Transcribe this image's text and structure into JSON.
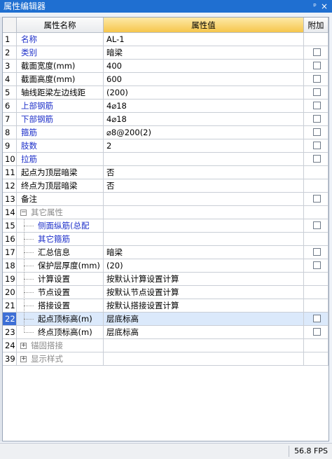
{
  "window": {
    "title": "属性编辑器",
    "pin_glyph": "ᵖ",
    "close_glyph": "×"
  },
  "header": {
    "name": "属性名称",
    "value": "属性值",
    "add": "附加"
  },
  "rows": [
    {
      "num": "1",
      "name": "名称",
      "value": "AL-1",
      "name_color": "blue",
      "check": false,
      "indent": 0
    },
    {
      "num": "2",
      "name": "类别",
      "value": "暗梁",
      "name_color": "blue",
      "check": true,
      "indent": 0
    },
    {
      "num": "3",
      "name": "截面宽度(mm)",
      "value": "400",
      "name_color": "black",
      "check": true,
      "indent": 0
    },
    {
      "num": "4",
      "name": "截面高度(mm)",
      "value": "600",
      "name_color": "black",
      "check": true,
      "indent": 0
    },
    {
      "num": "5",
      "name": "轴线距梁左边线距",
      "value": "(200)",
      "name_color": "black",
      "check": true,
      "indent": 0
    },
    {
      "num": "6",
      "name": "上部钢筋",
      "value": "4⌀18",
      "name_color": "blue",
      "check": true,
      "indent": 0
    },
    {
      "num": "7",
      "name": "下部钢筋",
      "value": "4⌀18",
      "name_color": "blue",
      "check": true,
      "indent": 0
    },
    {
      "num": "8",
      "name": "箍筋",
      "value": "⌀8@200(2)",
      "name_color": "blue",
      "check": true,
      "indent": 0
    },
    {
      "num": "9",
      "name": "肢数",
      "value": "2",
      "name_color": "blue",
      "check": true,
      "indent": 0
    },
    {
      "num": "10",
      "name": "拉筋",
      "value": "",
      "name_color": "blue",
      "check": true,
      "indent": 0
    },
    {
      "num": "11",
      "name": "起点为顶层暗梁",
      "value": "否",
      "name_color": "black",
      "check": false,
      "indent": 0
    },
    {
      "num": "12",
      "name": "终点为顶层暗梁",
      "value": "否",
      "name_color": "black",
      "check": false,
      "indent": 0
    },
    {
      "num": "13",
      "name": "备注",
      "value": "",
      "name_color": "black",
      "check": true,
      "indent": 0
    },
    {
      "num": "14",
      "name": "其它属性",
      "value": "",
      "name_color": "gray",
      "check": false,
      "group": "−"
    },
    {
      "num": "15",
      "name": "侧面纵筋(总配",
      "value": "",
      "name_color": "blue",
      "check": true,
      "indent": 1
    },
    {
      "num": "16",
      "name": "其它箍筋",
      "value": "",
      "name_color": "blue",
      "check": false,
      "indent": 1
    },
    {
      "num": "17",
      "name": "汇总信息",
      "value": "暗梁",
      "name_color": "black",
      "check": true,
      "indent": 1
    },
    {
      "num": "18",
      "name": "保护层厚度(mm)",
      "value": "(20)",
      "name_color": "black",
      "check": true,
      "indent": 1
    },
    {
      "num": "19",
      "name": "计算设置",
      "value": "按默认计算设置计算",
      "name_color": "black",
      "check": false,
      "indent": 1
    },
    {
      "num": "20",
      "name": "节点设置",
      "value": "按默认节点设置计算",
      "name_color": "black",
      "check": false,
      "indent": 1
    },
    {
      "num": "21",
      "name": "搭接设置",
      "value": "按默认搭接设置计算",
      "name_color": "black",
      "check": false,
      "indent": 1
    },
    {
      "num": "22",
      "name": "起点顶标高(m)",
      "value": "层底标高",
      "name_color": "black",
      "check": true,
      "indent": 1,
      "selected": true
    },
    {
      "num": "23",
      "name": "终点顶标高(m)",
      "value": "层底标高",
      "name_color": "black",
      "check": true,
      "indent": 1,
      "last": true
    },
    {
      "num": "24",
      "name": "锚固搭接",
      "value": "",
      "name_color": "gray",
      "check": false,
      "group": "+"
    },
    {
      "num": "39",
      "name": "显示样式",
      "value": "",
      "name_color": "gray",
      "check": false,
      "group": "+"
    }
  ],
  "status": {
    "fps": "56.8 FPS"
  }
}
